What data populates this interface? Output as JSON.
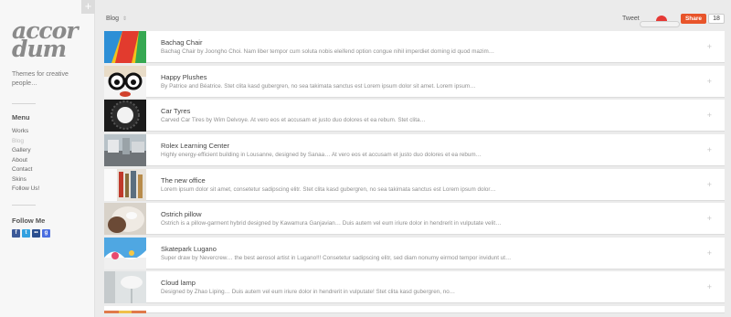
{
  "sidebar": {
    "logo": "accor dum",
    "logo_line1": "accor",
    "logo_line2": "dum",
    "tagline": "Themes for creative people…",
    "menu_title": "Menu",
    "menu_items": [
      {
        "label": "Works",
        "active": false
      },
      {
        "label": "Blog",
        "active": true
      },
      {
        "label": "Gallery",
        "active": false
      },
      {
        "label": "About",
        "active": false
      },
      {
        "label": "Contact",
        "active": false
      },
      {
        "label": "Skins",
        "active": false
      },
      {
        "label": "Follow Us!",
        "active": false
      }
    ],
    "follow_title": "Follow Me",
    "social_icons": [
      "facebook-icon",
      "twitter-icon",
      "flickr-icon",
      "google-icon"
    ]
  },
  "header": {
    "add_tab": "+",
    "breadcrumb": "Blog",
    "breadcrumb_chevron": "⇕",
    "tweet_label": "Tweet",
    "share_label": "Share",
    "share_count": "18"
  },
  "posts": [
    {
      "title": "Bachag Chair",
      "excerpt": "Bachag Chair by Joongho Choi. Nam liber tempor cum soluta nobis eleifend option congue nihil imperdiet doming id quod mazim…"
    },
    {
      "title": "Happy Plushes",
      "excerpt": "By Patrice and Béatrice. Stet clita kasd gubergren, no sea takimata sanctus est Lorem ipsum dolor sit amet. Lorem ipsum…"
    },
    {
      "title": "Car Tyres",
      "excerpt": "Carved Car Tires by Wim Delvoye. At vero eos et accusam et justo duo dolores et ea rebum. Stet clita…"
    },
    {
      "title": "Rolex Learning Center",
      "excerpt": "Highly energy-efficient building in Lousanne, designed by Sanaa… At vero eos et accusam et justo duo dolores et ea rebum…"
    },
    {
      "title": "The new office",
      "excerpt": "Lorem ipsum dolor sit amet, consetetur sadipscing elitr. Stet clita kasd gubergren, no sea takimata sanctus est Lorem ipsum dolor…"
    },
    {
      "title": "Ostrich pillow",
      "excerpt": "Ostrich is a pillow-garment hybrid designed by Kawamura Ganjavian… Duis autem vel eum iriure dolor in hendrerit in vulputate velit…"
    },
    {
      "title": "Skatepark Lugano",
      "excerpt": "Super draw by Nevercrew… the best aerosol artist in Lugano!!! Consetetur sadipscing elitr, sed diam nonumy eirmod tempor invidunt ut…"
    },
    {
      "title": "Cloud lamp",
      "excerpt": "Designed by Zhao Liping… Duis autem vel eum iriure dolor in hendrerit in vulputate! Stet clita kasd gubergren, no…"
    }
  ],
  "expand_icon": "+",
  "colors": {
    "share": "#e8542a",
    "tweet_flag": "#e53935"
  }
}
